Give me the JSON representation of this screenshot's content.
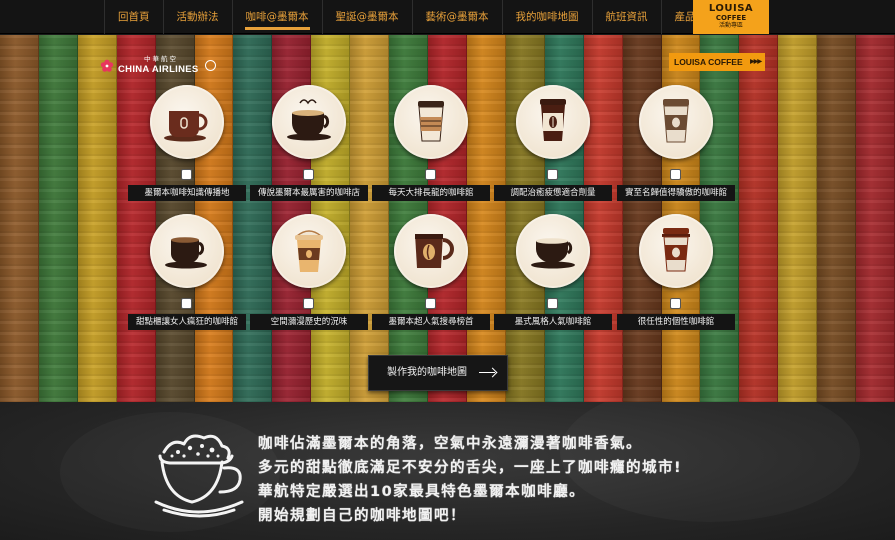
{
  "nav": {
    "items": [
      {
        "label": "回首頁"
      },
      {
        "label": "活動辦法"
      },
      {
        "label": "咖啡@墨爾本",
        "active": true
      },
      {
        "label": "聖誕@墨爾本"
      },
      {
        "label": "藝術@墨爾本"
      },
      {
        "label": "我的咖啡地圖"
      },
      {
        "label": "航班資訊"
      },
      {
        "label": "產品介紹"
      }
    ],
    "louisa_tab": {
      "line1": "LOUISA",
      "line2": "COFFEE",
      "line3": "活動專區"
    }
  },
  "logo": {
    "chinese": "中華航空",
    "english": "CHINA AIRLINES"
  },
  "louisa_button": {
    "label": "LOUISA COFFEE",
    "arrow": "▶▶▶"
  },
  "cafes": [
    {
      "label": "墨爾本咖啡知識傳播地",
      "icon": "coffee-cup-saucer-icon",
      "checked": false
    },
    {
      "label": "傳說墨爾本最厲害的咖啡店",
      "icon": "cappuccino-cup-icon",
      "checked": false
    },
    {
      "label": "每天大排長龍的咖啡館",
      "icon": "takeaway-cup-sleeve-icon",
      "checked": false
    },
    {
      "label": "調配治癒疲憊適合劑量",
      "icon": "coffee-bean-cup-icon",
      "checked": false
    },
    {
      "label": "實至名歸值得驕傲的咖啡館",
      "icon": "takeaway-bean-cup-icon",
      "checked": false
    },
    {
      "label": "甜點櫃讓女人瘋狂的咖啡館",
      "icon": "espresso-cup-icon",
      "checked": false
    },
    {
      "label": "空間瀰漫歷史的況味",
      "icon": "latte-cup-icon",
      "checked": false
    },
    {
      "label": "墨爾本超人氣搜尋榜首",
      "icon": "bean-mug-icon",
      "checked": false
    },
    {
      "label": "墨式風格人氣咖啡館",
      "icon": "flat-white-cup-icon",
      "checked": false
    },
    {
      "label": "很任性的個性咖啡館",
      "icon": "takeaway-cup-icon",
      "checked": false
    }
  ],
  "make_map_button": {
    "label": "製作我的咖啡地圖"
  },
  "intro": {
    "lines": [
      "咖啡佔滿墨爾本的角落，空氣中永遠瀰漫著咖啡香氣。",
      "多元的甜點徹底滿足不安分的舌尖，一座上了咖啡癮的城市!",
      "華航特定嚴選出10家最具特色墨爾本咖啡廳。",
      "開始規劃自己的咖啡地圖吧！"
    ]
  },
  "colors": {
    "nav_text": "#e8a13a",
    "louisa_orange": "#f4a21b",
    "plank_colors": [
      "#8f5b2a",
      "#3f7a3a",
      "#c9a125",
      "#b7262a",
      "#5a4a2d",
      "#d97c1a",
      "#2f6d58",
      "#9c2230",
      "#c7b22a",
      "#d2a035",
      "#3e7d3b",
      "#b7262a",
      "#d8881b",
      "#8a7a22",
      "#2f7a5c",
      "#c93a2c",
      "#6a3a1e",
      "#d28a1a",
      "#3a7a40",
      "#b93226",
      "#c6a12a",
      "#7a4e24",
      "#a82a2e"
    ]
  }
}
